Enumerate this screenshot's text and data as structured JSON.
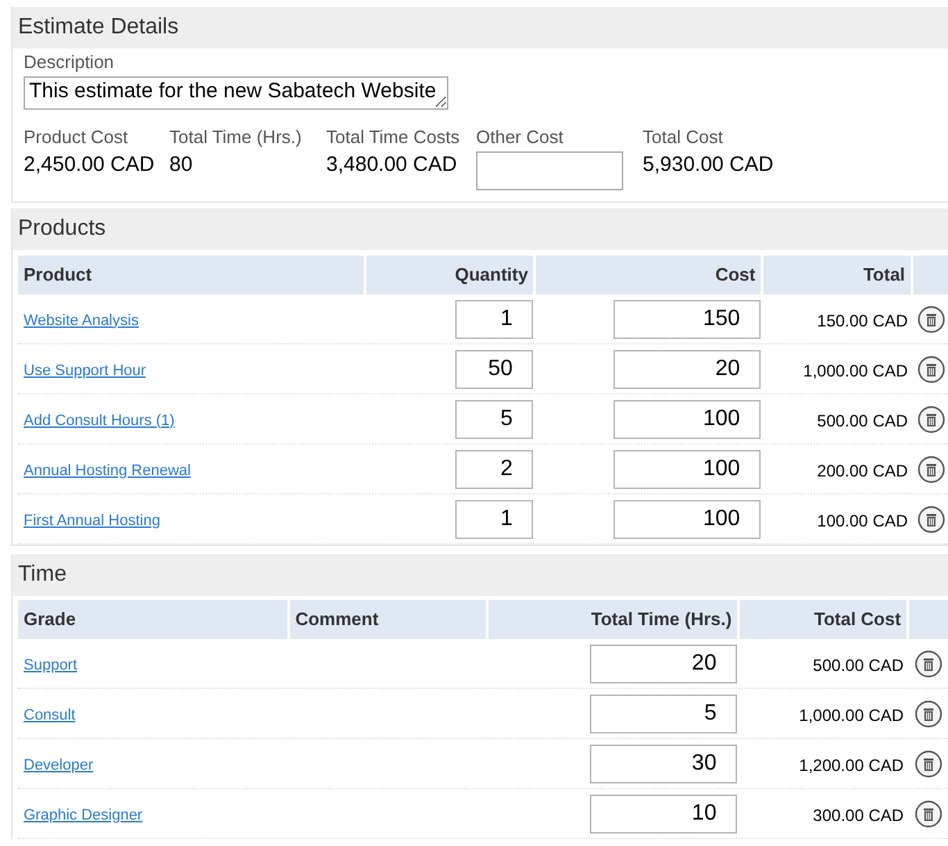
{
  "estimate_details": {
    "title": "Estimate Details",
    "description": {
      "label": "Description",
      "value": "This estimate for the new Sabatech Website"
    },
    "summary": [
      {
        "kind": "text",
        "label": "Product Cost",
        "value": "2,450.00 CAD"
      },
      {
        "kind": "text",
        "label": "Total Time (Hrs.)",
        "value": "80"
      },
      {
        "kind": "text",
        "label": "Total Time Costs",
        "value": "3,480.00 CAD"
      },
      {
        "kind": "field",
        "label": "Other Cost"
      },
      {
        "kind": "text",
        "label": "Total Cost",
        "value": "5,930.00 CAD"
      }
    ]
  },
  "products": {
    "title": "Products",
    "columns": [
      "Product",
      "Quantity",
      "Cost",
      "Total"
    ],
    "rows": [
      {
        "product": "Website Analysis",
        "quantity": "1",
        "cost": "150",
        "total": "150.00 CAD"
      },
      {
        "product": "Use Support Hour",
        "quantity": "50",
        "cost": "20",
        "total": "1,000.00 CAD"
      },
      {
        "product": "Add Consult Hours (1)",
        "quantity": "5",
        "cost": "100",
        "total": "500.00 CAD"
      },
      {
        "product": "Annual Hosting Renewal",
        "quantity": "2",
        "cost": "100",
        "total": "200.00 CAD"
      },
      {
        "product": "First Annual Hosting",
        "quantity": "1",
        "cost": "100",
        "total": "100.00 CAD"
      }
    ]
  },
  "time": {
    "title": "Time",
    "columns": [
      "Grade",
      "Comment",
      "Total Time (Hrs.)",
      "Total Cost"
    ],
    "rows": [
      {
        "grade": "Support",
        "hours": "20",
        "total_cost": "500.00 CAD"
      },
      {
        "grade": "Consult",
        "hours": "5",
        "total_cost": "1,000.00 CAD"
      },
      {
        "grade": "Developer",
        "hours": "30",
        "total_cost": "1,200.00 CAD"
      },
      {
        "grade": "Graphic Designer",
        "hours": "10",
        "total_cost": "300.00 CAD"
      }
    ]
  }
}
